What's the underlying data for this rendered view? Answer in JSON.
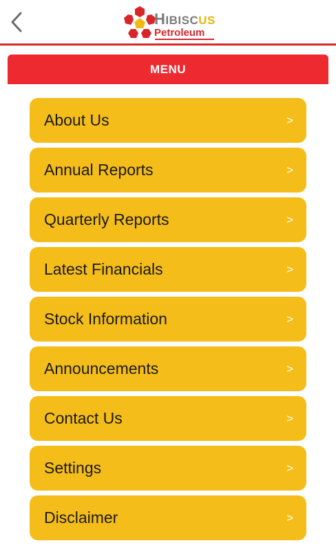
{
  "header": {
    "back_icon": "chevron-left-icon",
    "logo": {
      "name_prefix": "H",
      "name_mid": "IBISC",
      "name_accent": "US",
      "subtitle": "Petroleum",
      "colors": {
        "red": "#d9262b",
        "gray": "#7a7a7a",
        "yellow": "#e9b50c"
      }
    }
  },
  "menu": {
    "title": "MENU",
    "color": "#ec2a30",
    "item_color": "#f5bd1a",
    "items": [
      {
        "label": "About Us",
        "arrow": ">"
      },
      {
        "label": "Annual Reports",
        "arrow": ">"
      },
      {
        "label": "Quarterly Reports",
        "arrow": ">"
      },
      {
        "label": "Latest Financials",
        "arrow": ">"
      },
      {
        "label": "Stock Information",
        "arrow": ">"
      },
      {
        "label": "Announcements",
        "arrow": ">"
      },
      {
        "label": "Contact Us",
        "arrow": ">"
      },
      {
        "label": "Settings",
        "arrow": ">"
      },
      {
        "label": "Disclaimer",
        "arrow": ">"
      }
    ]
  }
}
